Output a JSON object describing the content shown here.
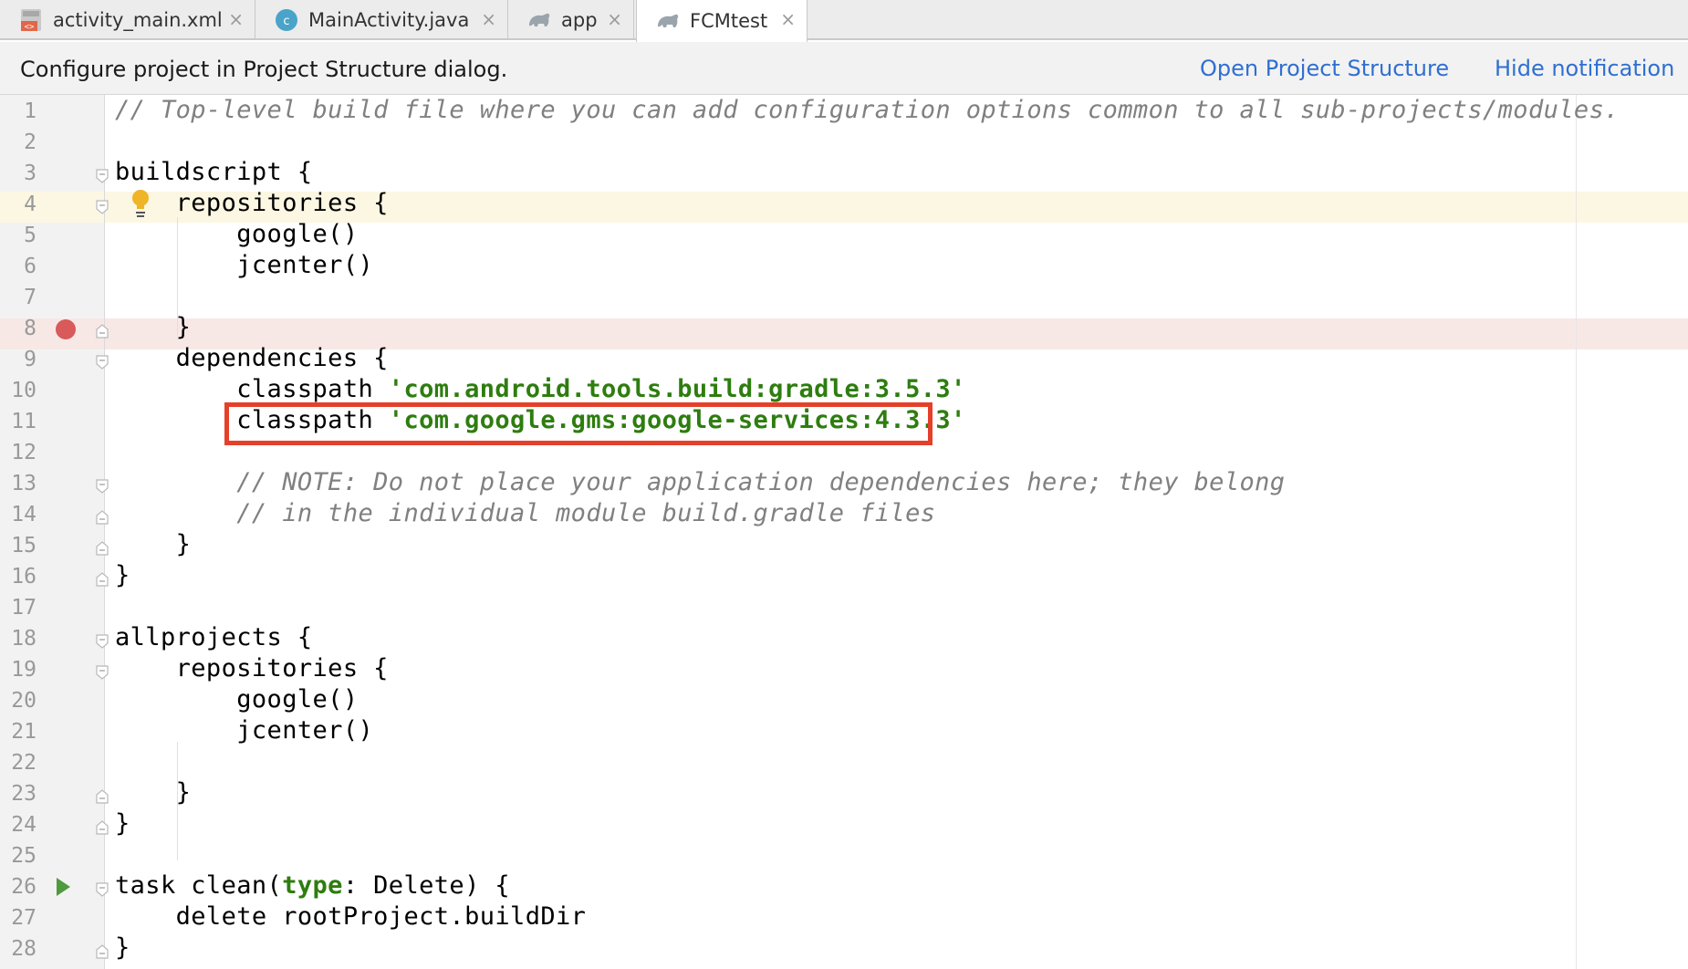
{
  "tabs": [
    {
      "label": "activity_main.xml",
      "icon": "xml-layout-icon",
      "active": false
    },
    {
      "label": "MainActivity.java",
      "icon": "java-class-icon",
      "active": false
    },
    {
      "label": "app",
      "icon": "gradle-elephant-icon",
      "active": false
    },
    {
      "label": "FCMtest",
      "icon": "gradle-elephant-icon",
      "active": true
    }
  ],
  "notification": {
    "message": "Configure project in Project Structure dialog.",
    "open_link": "Open Project Structure",
    "hide_link": "Hide notification"
  },
  "editor": {
    "line_numbers": [
      "1",
      "2",
      "3",
      "4",
      "5",
      "6",
      "7",
      "8",
      "9",
      "10",
      "11",
      "12",
      "13",
      "14",
      "15",
      "16",
      "17",
      "18",
      "19",
      "20",
      "21",
      "22",
      "23",
      "24",
      "25",
      "26",
      "27",
      "28"
    ],
    "caret_line": 4,
    "breakpoint_line": 8,
    "run_line": 26,
    "highlighted_line": 11,
    "lines": {
      "l1": "// Top-level build file where you can add configuration options common to all sub-projects/modules.",
      "l3": "buildscript {",
      "l4": "    repositories {",
      "l5": "        google()",
      "l6": "        jcenter()",
      "l8": "    }",
      "l9": "    dependencies {",
      "l10_a": "        classpath ",
      "l10_b": "'com.android.tools.build:gradle:3.5.3'",
      "l11_a": "        classpath ",
      "l11_b": "'com.google.gms:google-services:4.3.3'",
      "l13": "        // NOTE: Do not place your application dependencies here; they belong",
      "l14": "        // in the individual module build.gradle files",
      "l15": "    }",
      "l16": "}",
      "l18": "allprojects {",
      "l19": "    repositories {",
      "l20": "        google()",
      "l21": "        jcenter()",
      "l23": "    }",
      "l24": "}",
      "l26_a": "task clean(",
      "l26_b": "type",
      "l26_c": ": Delete) {",
      "l27": "    delete rootProject.buildDir",
      "l28": "}"
    }
  },
  "colors": {
    "link": "#2f6fd0",
    "string": "#2e7d0f",
    "comment": "#808080",
    "highlight_border": "#e5402a",
    "breakpoint": "#d85a5a",
    "caret_line_bg": "#fcf7e3"
  }
}
